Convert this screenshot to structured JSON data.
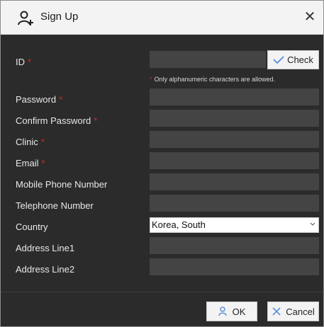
{
  "dialog": {
    "title": "Sign Up",
    "close_icon": "close-icon",
    "title_icon": "add-user-icon"
  },
  "form": {
    "id_label": "ID",
    "required_mark": "*",
    "check_label": "Check",
    "id_hint": "Only alphanumeric characters are allowed.",
    "password_label": "Password",
    "confirm_password_label": "Confirm Password",
    "clinic_label": "Clinic",
    "email_label": "Email",
    "mobile_label": "Mobile Phone Number",
    "telephone_label": "Telephone Number",
    "country_label": "Country",
    "country_value": "Korea, South",
    "address1_label": "Address Line1",
    "address2_label": "Address Line2"
  },
  "footer": {
    "ok_label": "OK",
    "cancel_label": "Cancel"
  },
  "colors": {
    "accent": "#4a86d8",
    "required": "#cc2a2a",
    "dialog_bg": "#2b2b2b",
    "field_bg": "#444444"
  }
}
